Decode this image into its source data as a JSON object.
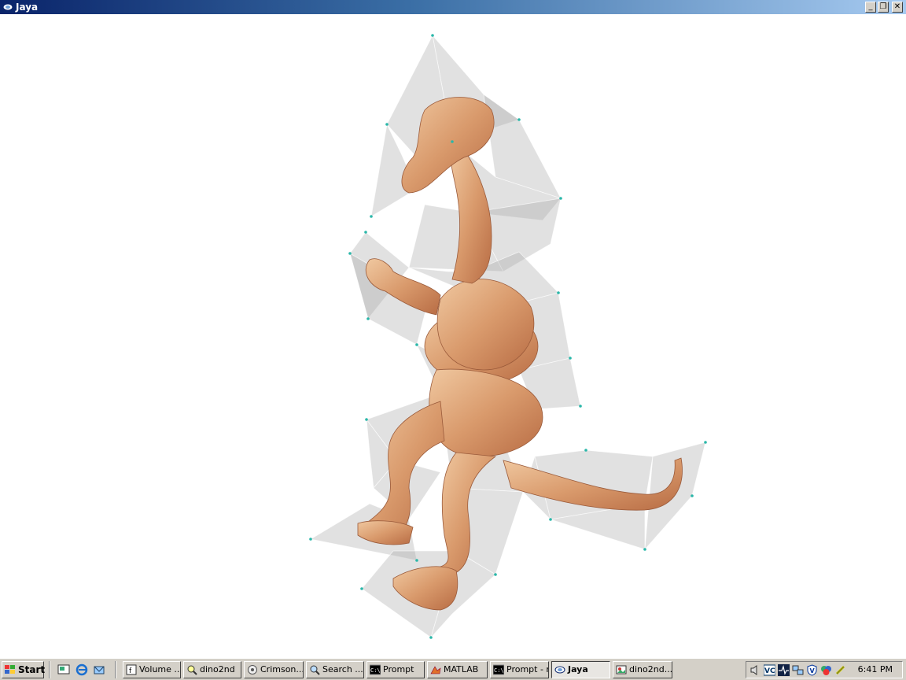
{
  "window": {
    "title": "Jaya"
  },
  "window_controls": {
    "minimize": "_",
    "restore": "❐",
    "close": "✕"
  },
  "taskbar": {
    "start_label": "Start",
    "tasks": [
      {
        "label": "Volume ...",
        "icon": "volume-app-icon",
        "active": false
      },
      {
        "label": "dino2nd",
        "icon": "folder-search-icon",
        "active": false
      },
      {
        "label": "Crimson...",
        "icon": "crimson-editor-icon",
        "active": false
      },
      {
        "label": "Search ...",
        "icon": "search-icon",
        "active": false
      },
      {
        "label": "Prompt",
        "icon": "command-prompt-icon",
        "active": false
      },
      {
        "label": "MATLAB",
        "icon": "matlab-icon",
        "active": false
      },
      {
        "label": "Prompt - r",
        "icon": "command-prompt-icon",
        "active": false
      },
      {
        "label": "Jaya",
        "icon": "jaya-app-icon",
        "active": true
      },
      {
        "label": "dino2nd...",
        "icon": "image-viewer-icon",
        "active": false
      }
    ],
    "clock": "6:41 PM"
  },
  "scene": {
    "description_visible": false,
    "model_color": "#d9956a",
    "hull_color": "#b0b0b0",
    "vertex_color": "#2ab7a9"
  }
}
